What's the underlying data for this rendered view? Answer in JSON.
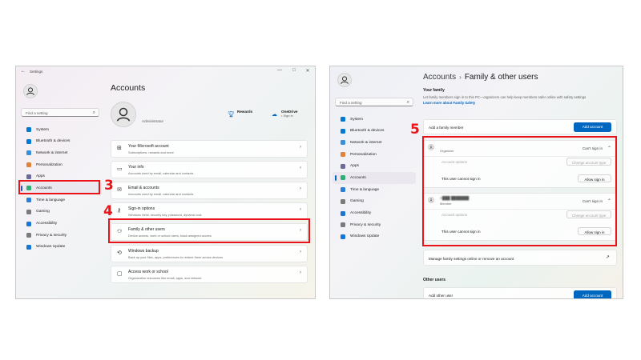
{
  "left": {
    "titlebar": {
      "title": "Settings",
      "back_glyph": "←",
      "minimize": "—",
      "maximize": "□",
      "close": "✕"
    },
    "search": {
      "placeholder": "Find a setting",
      "icon": "search-icon"
    },
    "nav": [
      {
        "label": "System",
        "icon": "monitor-icon",
        "color": "#0078d4"
      },
      {
        "label": "Bluetooth & devices",
        "icon": "bluetooth-icon",
        "color": "#0078d4"
      },
      {
        "label": "Network & internet",
        "icon": "wifi-icon",
        "color": "#3a8fd9"
      },
      {
        "label": "Personalization",
        "icon": "brush-icon",
        "color": "#e0823c"
      },
      {
        "label": "Apps",
        "icon": "apps-icon",
        "color": "#6b6b9a"
      },
      {
        "label": "Accounts",
        "icon": "person-icon",
        "color": "#2fae75",
        "active": true
      },
      {
        "label": "Time & language",
        "icon": "globe-clock-icon",
        "color": "#2a7ed8"
      },
      {
        "label": "Gaming",
        "icon": "gamepad-icon",
        "color": "#7a7a7a"
      },
      {
        "label": "Accessibility",
        "icon": "accessibility-icon",
        "color": "#1c76d0"
      },
      {
        "label": "Privacy & security",
        "icon": "shield-icon",
        "color": "#7b7b7b"
      },
      {
        "label": "Windows Update",
        "icon": "update-icon",
        "color": "#1677d2"
      }
    ],
    "page_title": "Accounts",
    "user_role": "Administrator",
    "rewards": {
      "title": "Rewards",
      "icon": "trophy-icon"
    },
    "onedrive": {
      "title": "OneDrive",
      "status": "• Sign in",
      "icon": "cloud-icon"
    },
    "cards": [
      {
        "title": "Your Microsoft account",
        "subtitle": "Subscriptions, rewards and more",
        "icon": "windows-icon"
      },
      {
        "title": "Your info",
        "subtitle": "Accounts used by email, calendar and contacts",
        "icon": "contact-card-icon"
      },
      {
        "title": "Email & accounts",
        "subtitle": "Accounts used by email, calendar and contacts",
        "icon": "mail-icon"
      },
      {
        "title": "Sign-in options",
        "subtitle": "Windows Hello, security key, password, dynamic lock",
        "icon": "key-icon"
      },
      {
        "title": "Family & other users",
        "subtitle": "Device access, work or school users, kiosk assigned access",
        "icon": "family-icon"
      },
      {
        "title": "Windows backup",
        "subtitle": "Back up your files, apps, preferences to restore them across devices",
        "icon": "backup-icon"
      },
      {
        "title": "Access work or school",
        "subtitle": "Organization resources like email, apps, and network",
        "icon": "briefcase-icon"
      }
    ],
    "chevron": "›"
  },
  "right": {
    "search": {
      "placeholder": "Find a setting",
      "icon": "search-icon"
    },
    "nav": [
      {
        "label": "System",
        "icon": "monitor-icon",
        "color": "#0078d4"
      },
      {
        "label": "Bluetooth & devices",
        "icon": "bluetooth-icon",
        "color": "#0078d4"
      },
      {
        "label": "Network & internet",
        "icon": "wifi-icon",
        "color": "#3a8fd9"
      },
      {
        "label": "Personalization",
        "icon": "brush-icon",
        "color": "#e0823c"
      },
      {
        "label": "Apps",
        "icon": "apps-icon",
        "color": "#6b6b9a"
      },
      {
        "label": "Accounts",
        "icon": "person-icon",
        "color": "#2fae75",
        "active": true
      },
      {
        "label": "Time & language",
        "icon": "globe-clock-icon",
        "color": "#2a7ed8"
      },
      {
        "label": "Gaming",
        "icon": "gamepad-icon",
        "color": "#7a7a7a"
      },
      {
        "label": "Accessibility",
        "icon": "accessibility-icon",
        "color": "#1c76d0"
      },
      {
        "label": "Privacy & security",
        "icon": "shield-icon",
        "color": "#7b7b7b"
      },
      {
        "label": "Windows Update",
        "icon": "update-icon",
        "color": "#1677d2"
      }
    ],
    "breadcrumb": {
      "parent": "Accounts",
      "separator": "›",
      "current": "Family & other users"
    },
    "your_family": {
      "heading": "Your family",
      "description": "Let family members sign in to this PC—organizers can help keep members safer online with safety settings",
      "learn_more": "Learn more about Family Safety",
      "add_label": "Add a family member",
      "add_button": "Add account"
    },
    "members": [
      {
        "name": "",
        "role": "Organizer",
        "status": "Can't sign in",
        "options_label": "Account options",
        "change_type": "Change account type",
        "signin_text": "This user cannot sign in",
        "allow_button": "Allow sign in"
      },
      {
        "name": "A███ ███████",
        "role": "Member",
        "status": "Can't sign in",
        "options_label": "Account options",
        "change_type": "Change account type",
        "signin_text": "This user cannot sign in",
        "allow_button": "Allow sign in"
      }
    ],
    "manage_link": "Manage family settings online or remove an account",
    "external_icon": "↗",
    "other_users": {
      "heading": "Other users",
      "add_label": "Add other user",
      "add_button": "Add account"
    },
    "expand_glyph": "⌃"
  },
  "annotations": {
    "step3": "3",
    "step4": "4",
    "step5": "5",
    "color": "#e8141a"
  }
}
